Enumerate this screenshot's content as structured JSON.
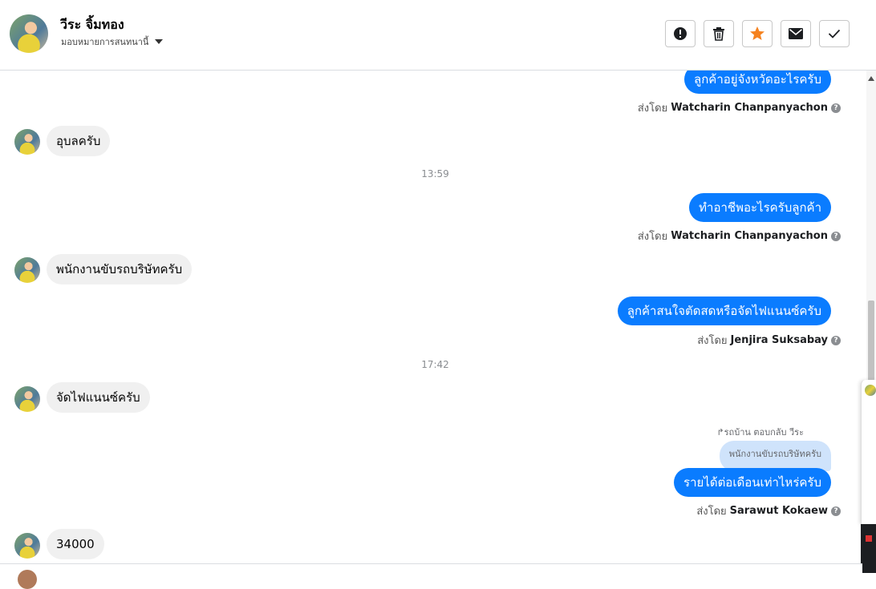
{
  "header": {
    "contact_name": "วีระ จิ้มทอง",
    "assign_label": "มอบหมายการสนทนานี้"
  },
  "toolbar": {
    "buttons": [
      {
        "name": "spam-button",
        "icon": "alert-icon"
      },
      {
        "name": "delete-button",
        "icon": "trash-icon"
      },
      {
        "name": "star-button",
        "icon": "star-icon",
        "color": "#f5821f"
      },
      {
        "name": "mark-unread-button",
        "icon": "envelope-icon"
      },
      {
        "name": "mark-done-button",
        "icon": "check-icon"
      }
    ]
  },
  "messages": {
    "m1_text": "ลูกค้าอยู่จังหวัดอะไรครับ",
    "m1_sent_prefix": "ส่งโดย",
    "m1_sender": "Watcharin Chanpanyachon",
    "m2_text": "อุบลครับ",
    "time1": "13:59",
    "m3_text": "ทำอาชีพอะไรครับลูกค้า",
    "m3_sent_prefix": "ส่งโดย",
    "m3_sender": "Watcharin Chanpanyachon",
    "m4_text": "พนักงานขับรถบริษัทครับ",
    "m5_text": "ลูกค้าสนใจตัดสดหรือจัดไฟแนนซ์ครับ",
    "m5_sent_prefix": "ส่งโดย",
    "m5_sender": "Jenjira Suksabay",
    "time2": "17:42",
    "m6_text": "จัดไฟแนนซ์ครับ",
    "reply_label": "รถบ้าน ตอบกลับ วีระ",
    "reply_quote": "พนักงานขับรถบริษัทครับ",
    "m7_text": "รายได้ต่อเดือนเท่าไหร่ครับ",
    "m7_sent_prefix": "ส่งโดย",
    "m7_sender": "Sarawut Kokaew",
    "m8_text": "34000"
  },
  "colors": {
    "outgoing_bubble": "#0a7cff",
    "incoming_bubble": "#f0f0f0",
    "star": "#f5821f"
  }
}
